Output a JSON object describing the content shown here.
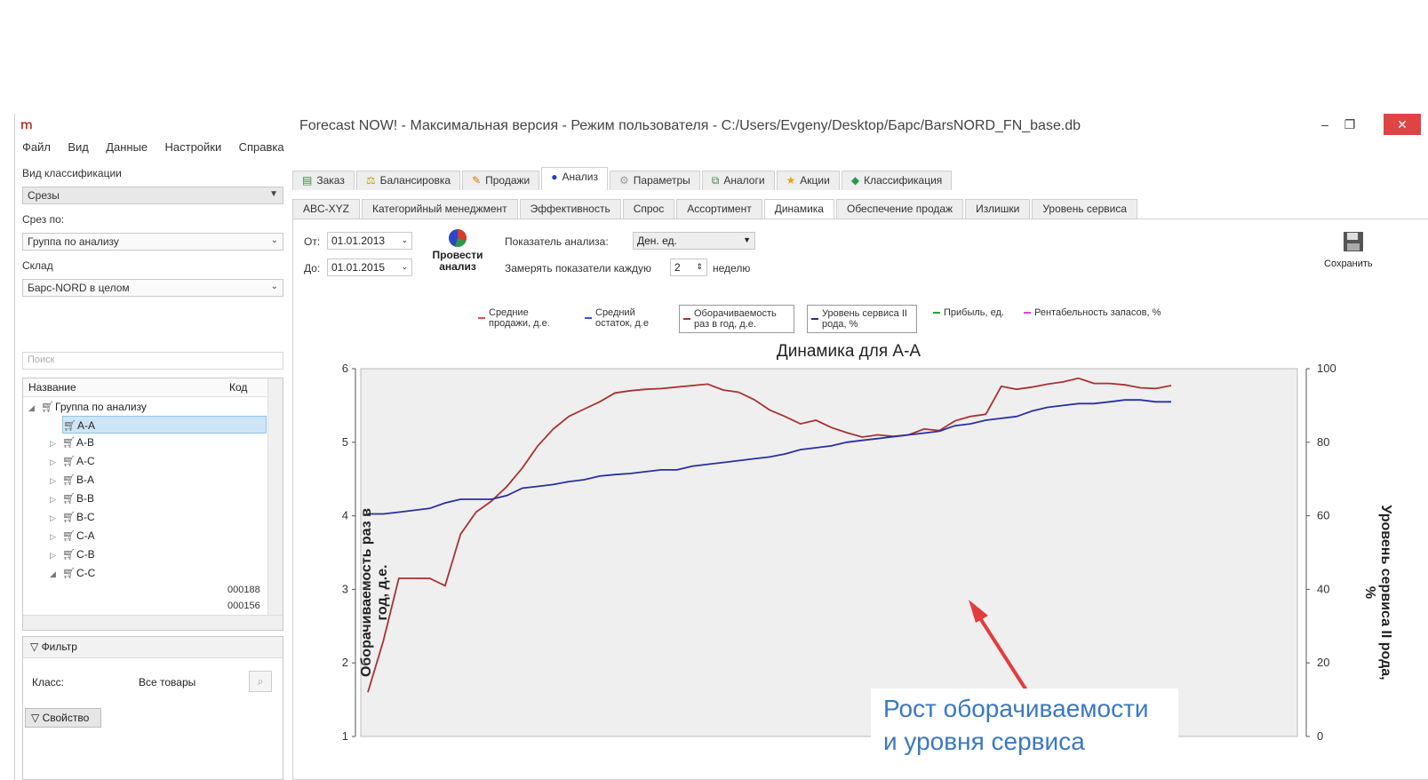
{
  "window": {
    "title": "Forecast NOW! - Максимальная версия - Режим пользователя - C:/Users/Evgeny/Desktop/Барс/BarsNORD_FN_base.db",
    "app_icon": "forecast-now-logo-icon"
  },
  "menu": [
    "Файл",
    "Вид",
    "Данные",
    "Настройки",
    "Справка"
  ],
  "left": {
    "class_label": "Вид классификации",
    "class_value": "Срезы",
    "slice_label": "Срез по:",
    "slice_value": "Группа по анализу",
    "warehouse_label": "Склад",
    "warehouse_value": "Барс-NORD в целом",
    "search_placeholder": "Поиск",
    "tree_col_name": "Название",
    "tree_col_code": "Код",
    "tree_root": "Группа по анализу",
    "tree_items": [
      "A-A",
      "A-B",
      "A-C",
      "B-A",
      "B-B",
      "B-C",
      "C-A",
      "C-B",
      "C-C"
    ],
    "codes": [
      "000188",
      "000156"
    ],
    "filter_title": "Фильтр",
    "filter_class_label": "Класс:",
    "filter_class_value": "Все товары",
    "property_button": "Свойство"
  },
  "tabs": [
    "Заказ",
    "Балансировка",
    "Продажи",
    "Анализ",
    "Параметры",
    "Аналоги",
    "Акции",
    "Классификация"
  ],
  "active_tab": "Анализ",
  "subtabs": [
    "ABC-XYZ",
    "Категорийный менеджмент",
    "Эффективность",
    "Спрос",
    "Ассортимент",
    "Динамика",
    "Обеспечение продаж",
    "Излишки",
    "Уровень сервиса"
  ],
  "active_subtab": "Динамика",
  "controls": {
    "from_label": "От:",
    "from_value": "01.01.2013",
    "to_label": "До:",
    "to_value": "01.01.2015",
    "analyze_button": "Провести анализ",
    "indicator_label": "Показатель анализа:",
    "indicator_value": "Ден. ед.",
    "measure_label": "Замерять показатели каждую",
    "measure_value": "2",
    "measure_unit": "неделю",
    "save_button": "Сохранить"
  },
  "legend": [
    {
      "label": "Средние продажи, д.е.",
      "color": "#e04a4a",
      "boxed": false
    },
    {
      "label": "Средний остаток, д.е",
      "color": "#3b4fd6",
      "boxed": false
    },
    {
      "label": "Оборачиваемость раз в год, д.е.",
      "color": "#b03030",
      "boxed": true
    },
    {
      "label": "Уровень сервиса II рода, %",
      "color": "#2a2aa0",
      "boxed": true
    },
    {
      "label": "Прибыль, ед.",
      "color": "#2aa12a",
      "boxed": false
    },
    {
      "label": "Рентабельность запасов, %",
      "color": "#e040e0",
      "boxed": false
    }
  ],
  "chart_data": {
    "type": "line",
    "title": "Динамика для A-A",
    "ylabel": "Оборачиваемость раз в год, д.е.",
    "y2label": "Уровень сервиса II рода, %",
    "ylim": [
      1,
      6
    ],
    "y2lim": [
      0,
      100
    ],
    "yticks": [
      1,
      2,
      3,
      4,
      5,
      6
    ],
    "y2ticks": [
      0,
      20,
      40,
      60,
      80,
      100
    ],
    "grid": false,
    "series": [
      {
        "name": "Оборачиваемость раз в год, д.е.",
        "axis": "left",
        "color": "#a83232",
        "values": [
          1.6,
          2.3,
          3.15,
          3.15,
          3.15,
          3.05,
          3.75,
          4.05,
          4.2,
          4.4,
          4.65,
          4.95,
          5.18,
          5.35,
          5.45,
          5.55,
          5.67,
          5.7,
          5.72,
          5.73,
          5.75,
          5.77,
          5.79,
          5.71,
          5.68,
          5.58,
          5.44,
          5.35,
          5.25,
          5.3,
          5.2,
          5.13,
          5.07,
          5.1,
          5.08,
          5.1,
          5.18,
          5.16,
          5.29,
          5.35,
          5.38,
          5.76,
          5.72,
          5.75,
          5.79,
          5.82,
          5.87,
          5.8,
          5.8,
          5.78,
          5.74,
          5.73,
          5.77
        ]
      },
      {
        "name": "Уровень сервиса II рода, %",
        "axis": "right",
        "color": "#2b2fa0",
        "values": [
          60.5,
          60.5,
          61.0,
          61.5,
          62.0,
          63.5,
          64.5,
          64.5,
          64.5,
          65.5,
          67.5,
          68.0,
          68.5,
          69.3,
          69.8,
          70.8,
          71.2,
          71.5,
          72.0,
          72.5,
          72.5,
          73.5,
          74.0,
          74.5,
          75.0,
          75.5,
          76.0,
          76.8,
          78.0,
          78.5,
          79.0,
          80.0,
          80.5,
          81.0,
          81.5,
          82.0,
          82.5,
          83.0,
          84.5,
          85.0,
          86.0,
          86.5,
          87.0,
          88.5,
          89.5,
          90.0,
          90.5,
          90.5,
          91.0,
          91.5,
          91.5,
          91.0,
          91.0
        ]
      }
    ]
  },
  "annotation": {
    "text": "Рост оборачиваемости\nи уровня сервиса",
    "color": "#3a78c2",
    "arrow_color": "#e23c3c"
  }
}
